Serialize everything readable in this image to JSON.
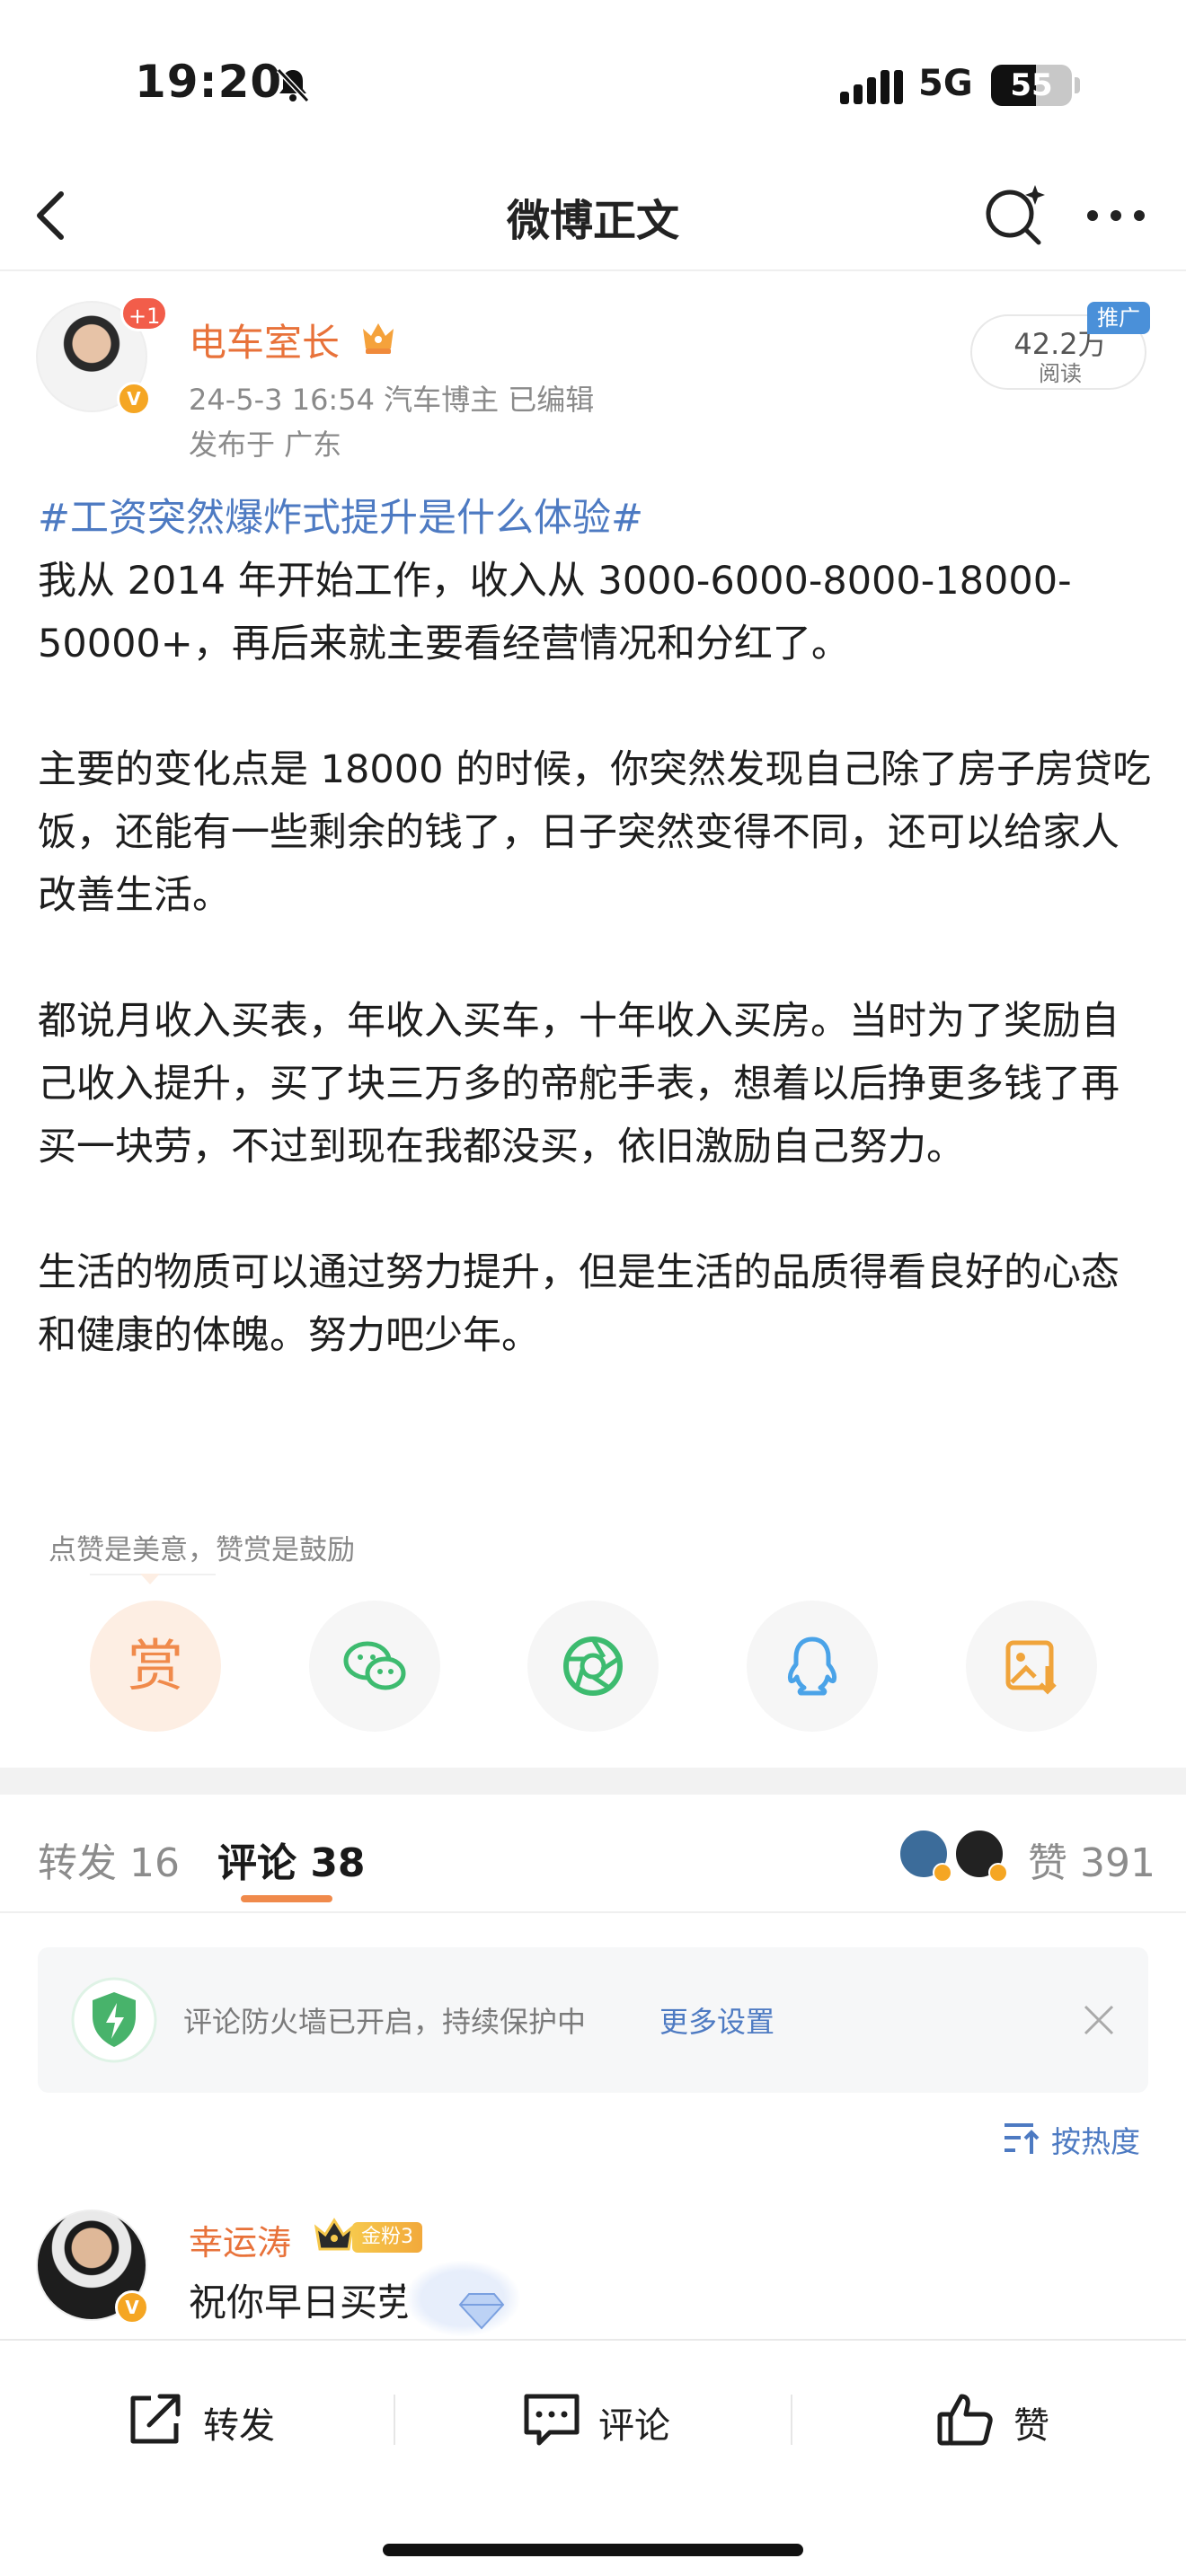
{
  "status_bar": {
    "time": "19:20",
    "network": "5G",
    "battery": "55",
    "battery_level": 0.55
  },
  "nav": {
    "title": "微博正文"
  },
  "author": {
    "badge_count": "+1",
    "name": "电车室长",
    "meta": "24-5-3 16:54  汽车博主  已编辑",
    "location": "发布于 广东",
    "read_count": "42.2万",
    "read_label": "阅读",
    "promo_tag": "推广"
  },
  "post": {
    "hashtag": "#工资突然爆炸式提升是什么体验#",
    "paragraphs": [
      "我从 2014 年开始工作，收入从 3000-6000-8000-18000-50000+，再后来就主要看经营情况和分红了。",
      "主要的变化点是 18000 的时候，你突然发现自己除了房子房贷吃饭，还能有一些剩余的钱了，日子突然变得不同，还可以给家人改善生活。",
      "都说月收入买表，年收入买车，十年收入买房。当时为了奖励自己收入提升，买了块三万多的帝舵手表，想着以后挣更多钱了再买一块劳，不过到现在我都没买，依旧激励自己努力。",
      "生活的物质可以通过努力提升，但是生活的品质得看良好的心态和健康的体魄。努力吧少年。"
    ]
  },
  "reward": {
    "hint": "点赞是美意，赞赏是鼓励",
    "reward_char": "赏",
    "share_icons": [
      "reward-icon",
      "wechat-icon",
      "moments-icon",
      "qq-icon",
      "save-image-icon"
    ],
    "colors": {
      "reward": "#f08a4b",
      "wechat": "#3dbb6f",
      "moments": "#3dbb6f",
      "qq": "#4aa3e8",
      "save": "#f0a43b"
    }
  },
  "tabs": {
    "repost": "转发 16",
    "comment": "评论 38",
    "like": "赞 391"
  },
  "firewall": {
    "text": "评论防火墙已开启，持续保护中",
    "link": "更多设置"
  },
  "sort": {
    "label": "按热度"
  },
  "comment": {
    "name": "幸运涛",
    "fan_badge": "金粉3",
    "text": "祝你早日买劳"
  },
  "bottom_bar": {
    "repost": "转发",
    "comment": "评论",
    "like": "赞"
  },
  "colors": {
    "accent_orange": "#e8723a",
    "link_blue": "#4d7ac2",
    "verified_gold": "#f5a623"
  }
}
